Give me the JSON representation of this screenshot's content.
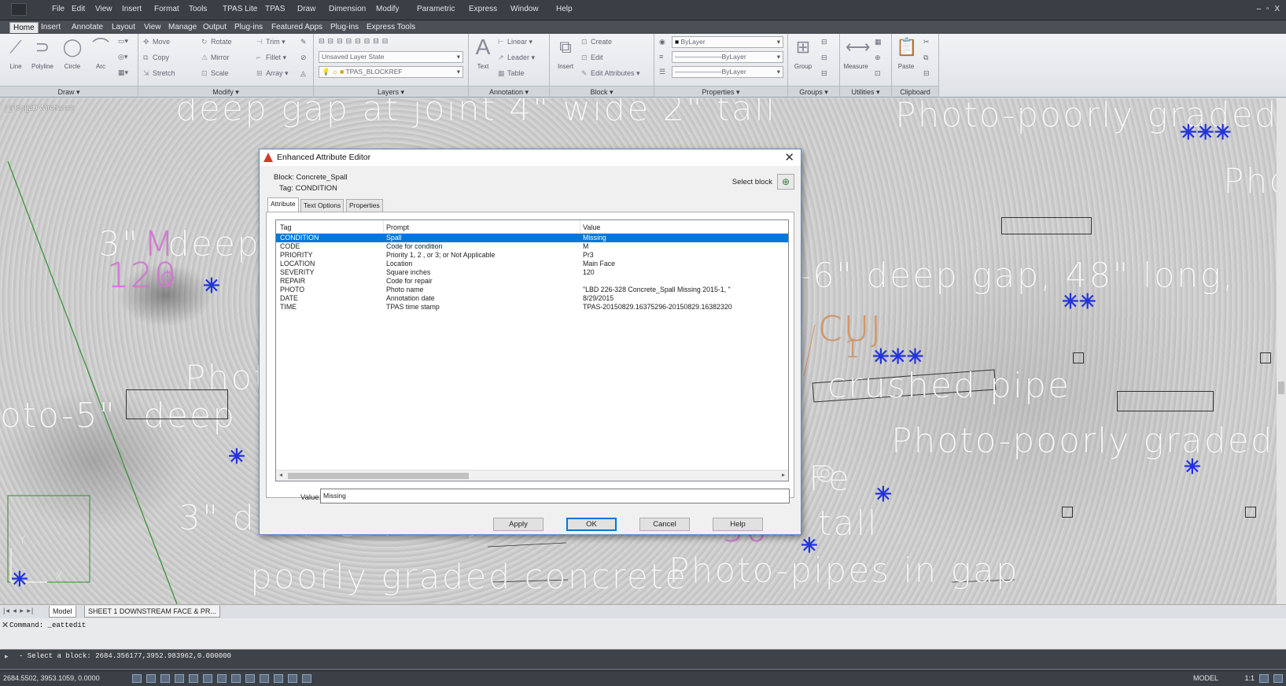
{
  "menu": {
    "items": [
      "File",
      "Edit",
      "View",
      "Insert",
      "Format",
      "Tools",
      "TPAS Lite",
      "TPAS",
      "Draw",
      "Dimension",
      "Modify",
      "Parametric",
      "Express",
      "Window",
      "Help"
    ],
    "window_controls": "– ▫ X"
  },
  "ribbon_tabs": [
    "Home",
    "Insert",
    "Annotate",
    "Layout",
    "View",
    "Manage",
    "Output",
    "Plug-ins",
    "Featured Apps",
    "Plug-ins",
    "Express Tools"
  ],
  "ribbon": {
    "draw": {
      "title": "Draw ▾",
      "buttons": [
        "Line",
        "Polyline",
        "Circle",
        "Arc"
      ]
    },
    "modify": {
      "title": "Modify ▾",
      "buttons": [
        "Move",
        "Rotate",
        "Trim ▾",
        "Copy",
        "Mirror",
        "Fillet ▾",
        "Stretch",
        "Scale",
        "Array ▾"
      ]
    },
    "layers": {
      "title": "Layers ▾",
      "layer_state": "Unsaved Layer State",
      "current_layer": "TPAS_BLOCKREF"
    },
    "annotation": {
      "title": "Annotation ▾",
      "text": "Text",
      "buttons": [
        "Linear ▾",
        "Leader ▾",
        "Table"
      ]
    },
    "block": {
      "title": "Block ▾",
      "insert": "Insert",
      "buttons": [
        "Create",
        "Edit",
        "Edit Attributes ▾"
      ]
    },
    "properties": {
      "title": "Properties ▾",
      "color": "ByLayer",
      "linetype": "ByLayer",
      "lineweight": "ByLayer"
    },
    "groups": {
      "title": "Groups ▾",
      "button": "Group"
    },
    "utilities": {
      "title": "Utilities ▾",
      "button": "Measure"
    },
    "clipboard": {
      "title": "Clipboard",
      "button": "Paste"
    }
  },
  "viewport": {
    "label": "[-][Top][2D Wireframe]",
    "texts": [
      "deep gap at joint 4\" wide 2\" tall",
      "Photo-poorly graded",
      "Pho",
      "3\"",
      "deep",
      "-6\" deep gap, 48\" long,",
      "Phot",
      "crushed pipe",
      "oto-5\"",
      "deep",
      "Photo-poorly graded",
      "3\" deep gap at joint 2\" wide",
      "tall",
      "poorly graded concrete",
      "Photo-pipes in gap",
      "CUJ",
      "1",
      "Fe",
      "50",
      "M",
      "120",
      "Y",
      "X"
    ]
  },
  "dialog": {
    "title": "Enhanced Attribute Editor",
    "block_label": "Block: Concrete_Spall",
    "tag_label": "Tag: CONDITION",
    "select_block_label": "Select block",
    "tabs": [
      "Attribute",
      "Text Options",
      "Properties"
    ],
    "columns": [
      "Tag",
      "Prompt",
      "Value"
    ],
    "rows": [
      {
        "tag": "CONDITION",
        "prompt": "Spall",
        "value": "Missing"
      },
      {
        "tag": "CODE",
        "prompt": "Code for condition",
        "value": "M"
      },
      {
        "tag": "PRIORITY",
        "prompt": "Priority 1, 2 , or 3; or Not Applicable",
        "value": "Pr3"
      },
      {
        "tag": "LOCATION",
        "prompt": "Location",
        "value": "Main Face"
      },
      {
        "tag": "SEVERITY",
        "prompt": "Square inches",
        "value": "120"
      },
      {
        "tag": "REPAIR",
        "prompt": "Code for repair",
        "value": ""
      },
      {
        "tag": "PHOTO",
        "prompt": "Photo name",
        "value": "\"LBD 226-328 Concrete_Spall Missing 2015-1, \""
      },
      {
        "tag": "DATE",
        "prompt": "Annotation date",
        "value": "8/29/2015"
      },
      {
        "tag": "TIME",
        "prompt": "TPAS time stamp",
        "value": "TPAS-20150829.16375296-20150829.16382320"
      }
    ],
    "value_label": "Value:",
    "value": "Missing",
    "buttons": {
      "apply": "Apply",
      "ok": "OK",
      "cancel": "Cancel",
      "help": "Help"
    }
  },
  "layout_tabs": {
    "nav": "|◂ ◂ ▸ ▸|",
    "model": "Model",
    "sheet": "SHEET 1 DOWNSTREAM FACE & PR..."
  },
  "command": {
    "history": "Command: _eattedit",
    "prompt": "- Select a block: 2684.356177,3952.983962,0.000000"
  },
  "status": {
    "coords": "2684.5502, 3953.1059, 0.0000",
    "model": "MODEL",
    "scale": "1:1"
  },
  "colors": {
    "accent": "#0078d7",
    "menubar": "#3b3f45",
    "cad_text": "#f6f6f6",
    "cad_magenta": "#d677d6",
    "cad_blue": "#2233dd"
  }
}
